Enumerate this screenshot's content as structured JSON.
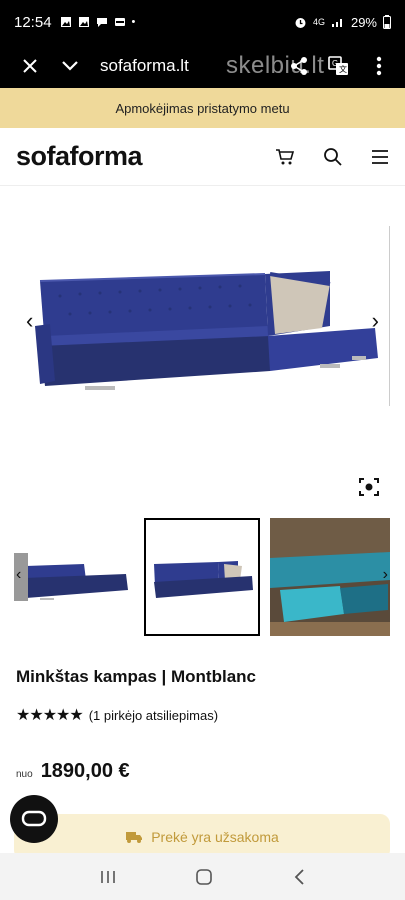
{
  "status_bar": {
    "time": "12:54",
    "battery": "29%",
    "icons": [
      "image-icon",
      "image-icon",
      "chat-icon",
      "wallet-icon",
      "dot-icon",
      "alarm-icon",
      "4g-icon",
      "signal-icon",
      "battery-icon"
    ]
  },
  "browser": {
    "url": "sofaforma.lt",
    "watermark": "skelbiu.lt",
    "icons": [
      "close-icon",
      "chevron-down-icon",
      "share-icon",
      "translate-icon",
      "more-icon"
    ]
  },
  "promo": {
    "text": "Apmokėjimas pristatymo metu"
  },
  "header": {
    "logo": "sofaforma",
    "icons": [
      "cart-icon",
      "search-icon",
      "menu-icon"
    ]
  },
  "product": {
    "title": "Minkštas kampas | Montblanc",
    "rating_stars": 5,
    "rating_text": "(1 pirkėjo atsiliepimas)",
    "price_prefix": "nuo",
    "price": "1890,00 €",
    "order_status": "Prekė yra užsakoma"
  },
  "gallery": {
    "selected_index": 1,
    "thumb_count_visible": 3
  },
  "colors": {
    "promo_bg": "#efd99a",
    "sofa_blue": "#2f3c8f",
    "order_bg": "#f9f0d2",
    "order_text": "#c19a3b"
  }
}
